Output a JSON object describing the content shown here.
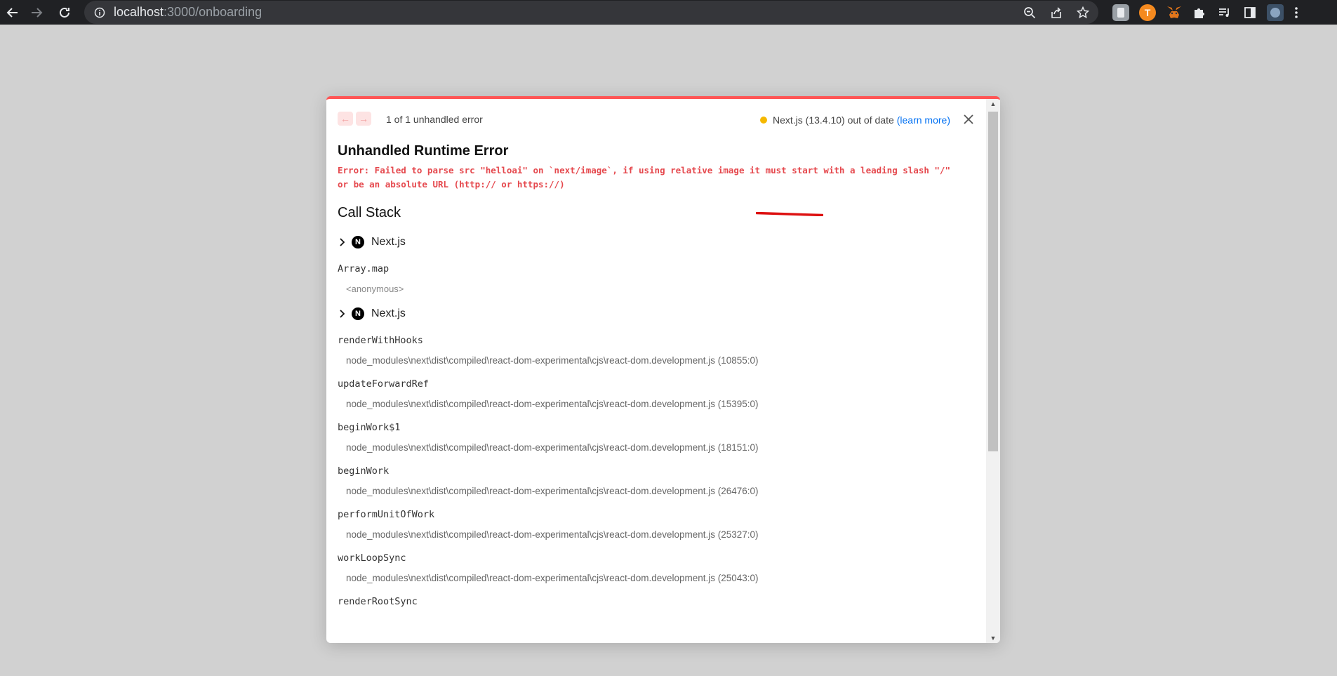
{
  "browser": {
    "url_host": "localhost",
    "url_rest": ":3000/onboarding",
    "extensions": [
      "account-ext-icon",
      "t-ext-icon",
      "metamask-fox-icon",
      "puzzle-icon",
      "media-queue-icon",
      "side-panel-icon",
      "profile-avatar-icon",
      "kebab-menu-icon"
    ]
  },
  "overlay": {
    "error_count": "1 of 1 unhandled error",
    "version_text": "Next.js (13.4.10) out of date",
    "learn_more": "(learn more)",
    "title": "Unhandled Runtime Error",
    "message_line1": "Error: Failed to parse src \"helloai\" on `next/image`, if using relative image it must start with a leading slash \"/\"",
    "message_line2": "or be an absolute URL (http:// or https://)",
    "call_stack_title": "Call Stack",
    "group1": "Next.js",
    "frame_arraymap": {
      "name": "Array.map",
      "loc": "<anonymous>"
    },
    "group2": "Next.js",
    "frames": [
      {
        "name": "renderWithHooks",
        "loc": "node_modules\\next\\dist\\compiled\\react-dom-experimental\\cjs\\react-dom.development.js (10855:0)"
      },
      {
        "name": "updateForwardRef",
        "loc": "node_modules\\next\\dist\\compiled\\react-dom-experimental\\cjs\\react-dom.development.js (15395:0)"
      },
      {
        "name": "beginWork$1",
        "loc": "node_modules\\next\\dist\\compiled\\react-dom-experimental\\cjs\\react-dom.development.js (18151:0)"
      },
      {
        "name": "beginWork",
        "loc": "node_modules\\next\\dist\\compiled\\react-dom-experimental\\cjs\\react-dom.development.js (26476:0)"
      },
      {
        "name": "performUnitOfWork",
        "loc": "node_modules\\next\\dist\\compiled\\react-dom-experimental\\cjs\\react-dom.development.js (25327:0)"
      },
      {
        "name": "workLoopSync",
        "loc": "node_modules\\next\\dist\\compiled\\react-dom-experimental\\cjs\\react-dom.development.js (25043:0)"
      },
      {
        "name": "renderRootSync",
        "loc": ""
      }
    ]
  }
}
